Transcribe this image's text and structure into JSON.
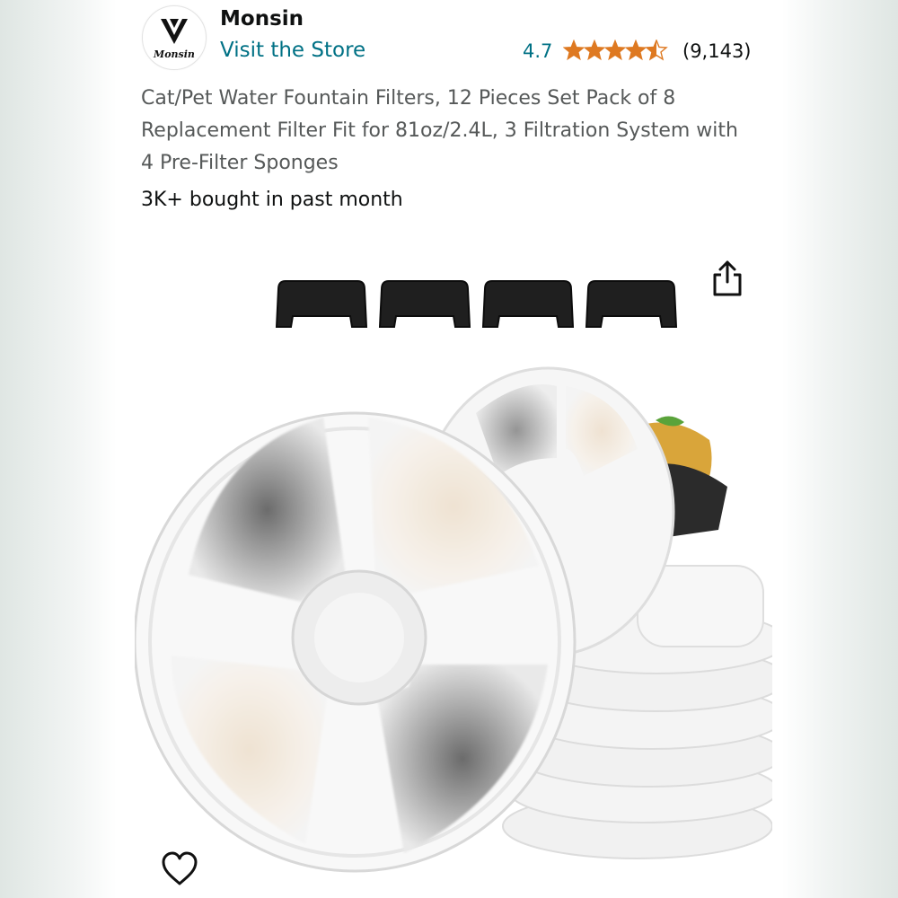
{
  "brand": {
    "logo_text": "Monsin",
    "name": "Monsin",
    "store_link": "Visit the Store"
  },
  "rating": {
    "value": "4.7",
    "stars": 4.5,
    "count": "(9,143)"
  },
  "product": {
    "title": "Cat/Pet Water Fountain Filters, 12 Pieces Set Pack of 8 Replacement Filter Fit for 81oz/2.4L, 3 Filtration System with 4 Pre-Filter Sponges",
    "social_proof": "3K+ bought in past month"
  },
  "icons": {
    "share": "share-icon",
    "favorite": "heart-icon",
    "star": "star-icon"
  },
  "colors": {
    "link": "#007185",
    "star": "#de7921",
    "text": "#0f1111",
    "title": "#565959"
  }
}
